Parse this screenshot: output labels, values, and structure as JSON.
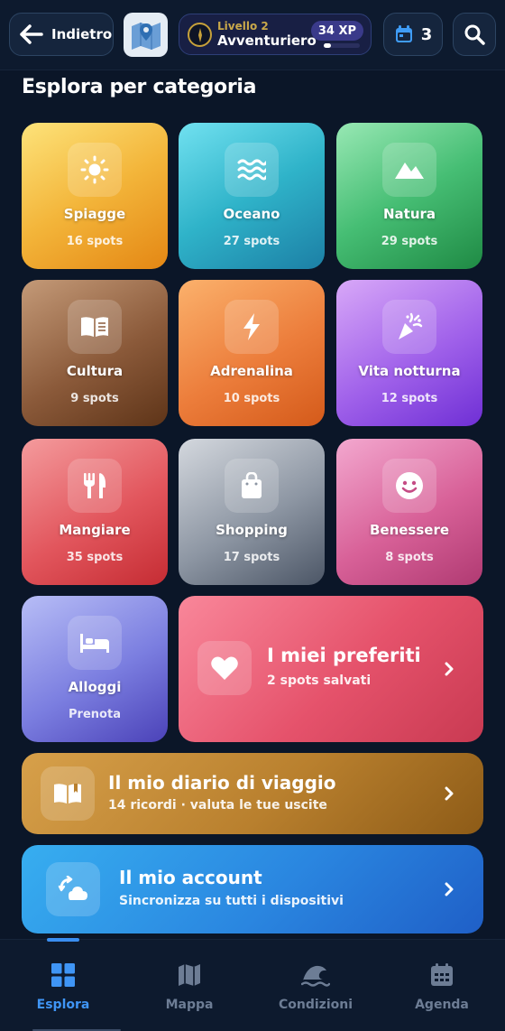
{
  "header": {
    "back_label": "Indietro",
    "level_small": "Livello 2",
    "level_title": "Avventuriero",
    "xp": "34 XP",
    "xp_progress": 0.2,
    "calendar_count": "3"
  },
  "section_title": "Esplora per categoria",
  "categories": [
    {
      "name": "Spiagge",
      "count": "16 spots",
      "icon": "sun-icon"
    },
    {
      "name": "Oceano",
      "count": "27 spots",
      "icon": "waves-icon"
    },
    {
      "name": "Natura",
      "count": "29 spots",
      "icon": "mountain-icon"
    },
    {
      "name": "Cultura",
      "count": "9 spots",
      "icon": "book-open-icon"
    },
    {
      "name": "Adrenalina",
      "count": "10 spots",
      "icon": "bolt-icon"
    },
    {
      "name": "Vita notturna",
      "count": "12 spots",
      "icon": "party-icon"
    },
    {
      "name": "Mangiare",
      "count": "35 spots",
      "icon": "utensils-icon"
    },
    {
      "name": "Shopping",
      "count": "17 spots",
      "icon": "shopping-bag-icon"
    },
    {
      "name": "Benessere",
      "count": "8 spots",
      "icon": "smile-icon"
    },
    {
      "name": "Alloggi",
      "count": "Prenota",
      "icon": "bed-icon"
    }
  ],
  "favorites": {
    "title": "I miei preferiti",
    "subtitle": "2 spots salvati",
    "icon": "heart-icon"
  },
  "diary": {
    "title": "Il mio diario di viaggio",
    "subtitle": "14 ricordi · valuta le tue uscite",
    "icon": "book-open-icon"
  },
  "account": {
    "title": "Il mio account",
    "subtitle": "Sincronizza su tutti i dispositivi",
    "icon": "cloud-sync-icon"
  },
  "nav": [
    {
      "label": "Esplora",
      "icon": "grid-icon",
      "active": true
    },
    {
      "label": "Mappa",
      "icon": "map-icon",
      "active": false
    },
    {
      "label": "Condizioni",
      "icon": "wave-icon",
      "active": false
    },
    {
      "label": "Agenda",
      "icon": "calendar-icon",
      "active": false
    }
  ],
  "colors": {
    "accent": "#3f95f5",
    "background": "#0b1628"
  }
}
